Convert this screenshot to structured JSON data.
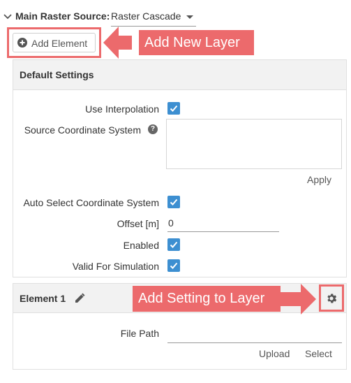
{
  "header": {
    "label": "Main Raster Source:",
    "source_value": "Raster Cascade"
  },
  "toolbar": {
    "add_element_label": "Add Element"
  },
  "callouts": {
    "add_layer": "Add New Layer",
    "add_setting": "Add Setting to Layer",
    "color": "#ec6a6c"
  },
  "default_settings": {
    "title": "Default Settings",
    "use_interpolation_label": "Use Interpolation",
    "use_interpolation_checked": true,
    "source_cs_label": "Source Coordinate System",
    "source_cs_value": "",
    "apply_label": "Apply",
    "auto_select_label": "Auto Select Coordinate System",
    "auto_select_checked": true,
    "offset_label": "Offset [m]",
    "offset_value": "0",
    "enabled_label": "Enabled",
    "enabled_checked": true,
    "valid_sim_label": "Valid For Simulation",
    "valid_sim_checked": true
  },
  "element1": {
    "title": "Element 1",
    "file_path_label": "File Path",
    "file_path_value": "",
    "upload_label": "Upload",
    "select_label": "Select"
  },
  "colors": {
    "accent_checkbox": "#3d8fd1",
    "callout": "#ec6a6c",
    "panel_header_bg": "#f2f2f2"
  }
}
